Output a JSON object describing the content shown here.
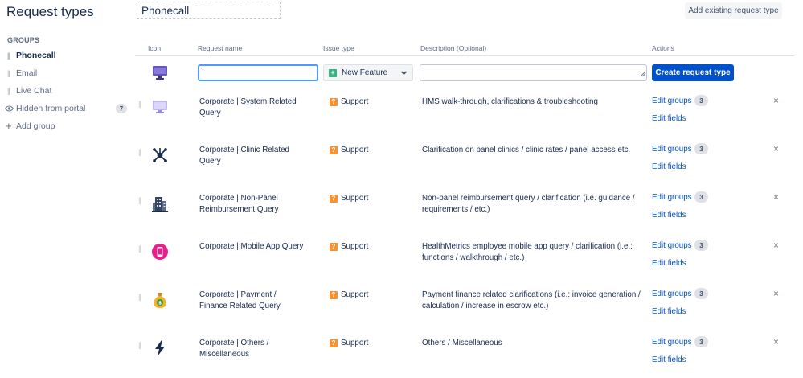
{
  "sidebar": {
    "title": "Request types",
    "groups_heading": "GROUPS",
    "groups": [
      {
        "label": "Phonecall"
      },
      {
        "label": "Email"
      },
      {
        "label": "Live Chat"
      },
      {
        "label": "Hidden from portal",
        "count": "7"
      }
    ],
    "add_group_label": "Add group"
  },
  "header": {
    "group_name": "Phonecall",
    "add_existing_label": "Add existing request type"
  },
  "table": {
    "columns": [
      "Icon",
      "Request name",
      "Issue type",
      "Description (Optional)",
      "Actions"
    ],
    "create_row": {
      "name_value": "",
      "issue_type_selected": "New Feature",
      "description_value": "",
      "create_button_label": "Create request type"
    },
    "rows": [
      {
        "icon": "monitor-icon",
        "name": "Corporate | System Related Query",
        "issue_type": "Support",
        "description": "HMS walk-through, clarifications & troubleshooting",
        "edit_groups_label": "Edit groups",
        "group_count": "3",
        "edit_fields_label": "Edit fields",
        "remove_glyph": "×"
      },
      {
        "icon": "network-icon",
        "name": "Corporate | Clinic Related Query",
        "issue_type": "Support",
        "description": "Clarification on panel clinics / clinic rates / panel access etc.",
        "edit_groups_label": "Edit groups",
        "group_count": "3",
        "edit_fields_label": "Edit fields",
        "remove_glyph": "×"
      },
      {
        "icon": "building-icon",
        "name": "Corporate | Non-Panel Reimbursement Query",
        "issue_type": "Support",
        "description": "Non-panel reimbursement query / clarification (i.e. guidance / requirements / etc.)",
        "edit_groups_label": "Edit groups",
        "group_count": "3",
        "edit_fields_label": "Edit fields",
        "remove_glyph": "×"
      },
      {
        "icon": "mobile-phone-icon",
        "name": "Corporate | Mobile App Query",
        "issue_type": "Support",
        "description": "HealthMetrics employee mobile app query / clarification (i.e.: functions / walkthrough / etc.)",
        "edit_groups_label": "Edit groups",
        "group_count": "3",
        "edit_fields_label": "Edit fields",
        "remove_glyph": "×"
      },
      {
        "icon": "money-bag-icon",
        "name": "Corporate | Payment / Finance Related Query",
        "issue_type": "Support",
        "description": "Payment finance related clarifications (i.e.: invoice generation / calculation / increase in escrow etc.)",
        "edit_groups_label": "Edit groups",
        "group_count": "3",
        "edit_fields_label": "Edit fields",
        "remove_glyph": "×"
      },
      {
        "icon": "lightning-icon",
        "name": "Corporate | Others / Miscellaneous",
        "issue_type": "Support",
        "description": "Others / Miscellaneous",
        "edit_groups_label": "Edit groups",
        "group_count": "3",
        "edit_fields_label": "Edit fields",
        "remove_glyph": "×"
      }
    ]
  },
  "colors": {
    "primary_button": "#0052cc",
    "link": "#0052cc",
    "support_issue": "#f79232",
    "new_feature_issue": "#36b37e",
    "focus_border": "#4c9aff"
  }
}
